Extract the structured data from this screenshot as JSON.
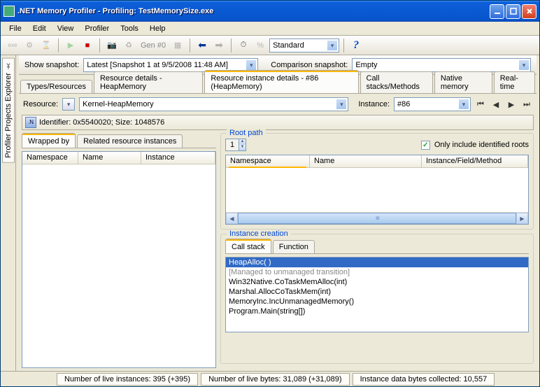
{
  "titlebar": ".NET Memory Profiler - Profiling: TestMemorySize.exe",
  "menu": [
    "File",
    "Edit",
    "View",
    "Profiler",
    "Tools",
    "Help"
  ],
  "toolbar": {
    "gen": "Gen #0",
    "layout": "Standard"
  },
  "snapshot": {
    "show_label": "Show snapshot:",
    "show_value": "Latest [Snapshot 1 at 9/5/2008 11:48 AM]",
    "compare_label": "Comparison snapshot:",
    "compare_value": "Empty"
  },
  "sidetab": "Profiler Projects Explorer",
  "maintabs": [
    "Types/Resources",
    "Resource details - HeapMemory",
    "Resource instance details - #86 (HeapMemory)",
    "Call stacks/Methods",
    "Native memory",
    "Real-time"
  ],
  "resource": {
    "label": "Resource:",
    "value": "Kernel-HeapMemory",
    "inst_label": "Instance:",
    "inst_value": "#86"
  },
  "identifier": "Identifier: 0x5540020; Size: 1048576",
  "left_tabs": [
    "Wrapped by",
    "Related resource instances"
  ],
  "left_cols": [
    "Namespace",
    "Name",
    "Instance"
  ],
  "root": {
    "group": "Root path",
    "spin": "1",
    "only_label": "Only include identified roots",
    "cols": [
      "Namespace",
      "Name",
      "Instance/Field/Method"
    ]
  },
  "creation": {
    "group": "Instance creation",
    "tabs": [
      "Call stack",
      "Function"
    ],
    "lines": [
      "HeapAlloc(  )",
      "[Managed to unmanaged transition]",
      "Win32Native.CoTaskMemAlloc(int)",
      "Marshal.AllocCoTaskMem(int)",
      "MemoryInc.IncUnmanagedMemory()",
      "Program.Main(string[])"
    ]
  },
  "status": {
    "inst": "Number of live instances: 395 (+395)",
    "bytes": "Number of live bytes: 31,089 (+31,089)",
    "collected": "Instance data bytes collected: 10,557"
  }
}
